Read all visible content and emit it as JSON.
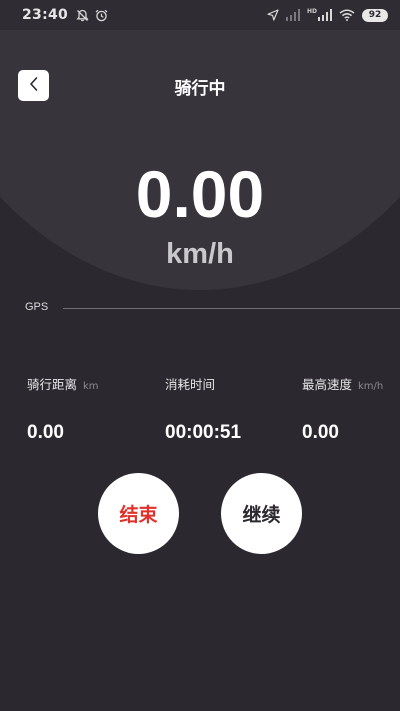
{
  "status_bar": {
    "time": "23:40",
    "battery": "92",
    "network_label": "HD",
    "icons": [
      "alarm-off-icon",
      "alarm-clock-icon",
      "location-arrow-icon",
      "signal-icon",
      "hd-signal-icon",
      "wifi-icon",
      "battery-icon"
    ]
  },
  "header": {
    "back_icon": "chevron-left-icon",
    "title": "骑行中"
  },
  "speed": {
    "value": "0.00",
    "unit": "km/h"
  },
  "gps": {
    "label": "GPS"
  },
  "stats": [
    {
      "label": "骑行距离",
      "unit": "km",
      "value": "0.00"
    },
    {
      "label": "消耗时间",
      "unit": "",
      "value": "00:00:51"
    },
    {
      "label": "最高速度",
      "unit": "km/h",
      "value": "0.00"
    }
  ],
  "actions": {
    "end_label": "结束",
    "continue_label": "继续"
  },
  "colors": {
    "background": "#2b2830",
    "arc": "#37343c",
    "end_text": "#e0322a",
    "button_bg": "#ffffff"
  }
}
